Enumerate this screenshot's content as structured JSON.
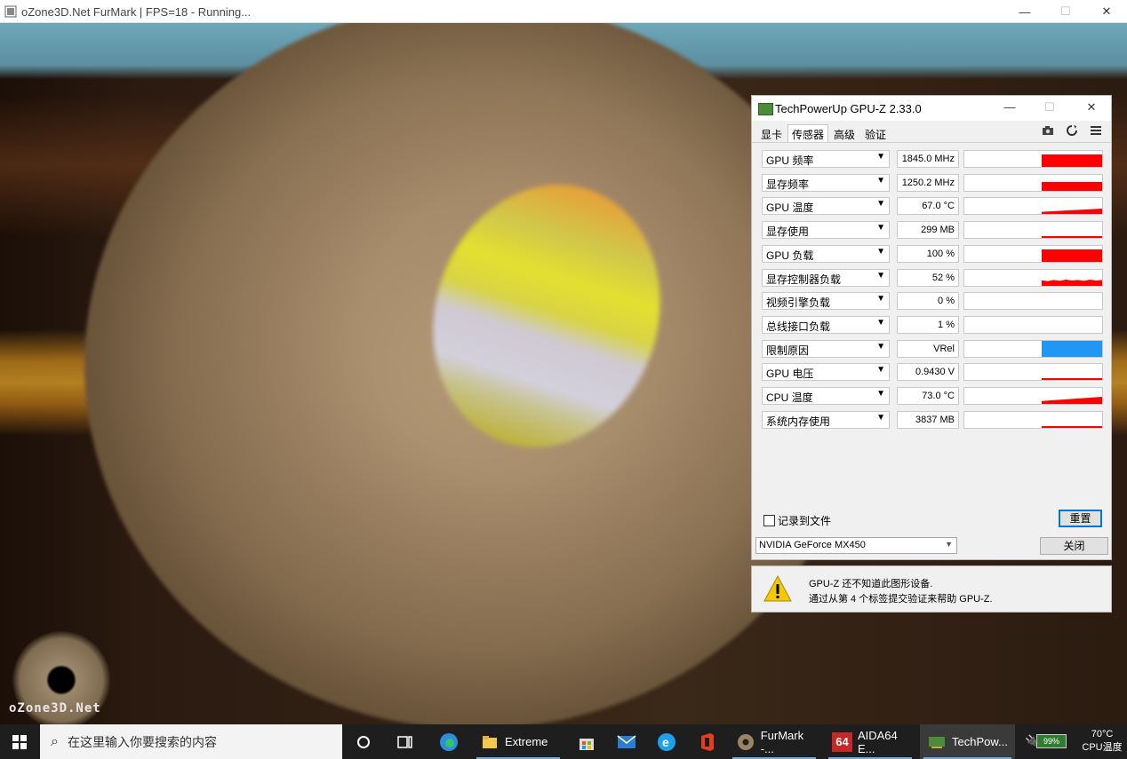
{
  "furmark": {
    "title": "oZone3D.Net FurMark | FPS=18 - Running...",
    "watermark": "oZone3D.Net"
  },
  "gpuz": {
    "title": "TechPowerUp GPU-Z 2.33.0",
    "tabs": [
      "显卡",
      "传感器",
      "高级",
      "验证"
    ],
    "active_tab": "传感器",
    "sensors": [
      {
        "name": "GPU 频率",
        "value": "1845.0 MHz",
        "level": 1.0,
        "shape": "full"
      },
      {
        "name": "显存频率",
        "value": "1250.2 MHz",
        "level": 0.7,
        "shape": "full"
      },
      {
        "name": "GPU 温度",
        "value": "67.0 °C",
        "level": 0.45,
        "shape": "ramp"
      },
      {
        "name": "显存使用",
        "value": "299 MB",
        "level": 0.1,
        "shape": "flat"
      },
      {
        "name": "GPU 负载",
        "value": "100 %",
        "level": 1.0,
        "shape": "full"
      },
      {
        "name": "显存控制器负载",
        "value": "52 %",
        "level": 0.5,
        "shape": "noisy"
      },
      {
        "name": "视频引擎负载",
        "value": "0 %",
        "level": 0.0,
        "shape": "flat"
      },
      {
        "name": "总线接口负载",
        "value": "1 %",
        "level": 0.02,
        "shape": "flat"
      },
      {
        "name": "限制原因",
        "value": "VRel",
        "level": 1.0,
        "shape": "blue"
      },
      {
        "name": "GPU 电压",
        "value": "0.9430 V",
        "level": 0.3,
        "shape": "flat"
      },
      {
        "name": "CPU 温度",
        "value": "73.0 °C",
        "level": 0.55,
        "shape": "ramp"
      },
      {
        "name": "系统内存使用",
        "value": "3837 MB",
        "level": 0.15,
        "shape": "flat"
      }
    ],
    "log_to_file_label": "记录到文件",
    "reset_label": "重置",
    "device": "NVIDIA GeForce MX450",
    "close_label": "关闭",
    "colors": {
      "graph": "#ff0000",
      "limit": "#2196f3"
    }
  },
  "gpuz_info": {
    "line1": "GPU-Z 还不知道此图形设备.",
    "line2": "通过从第 4 个标签提交验证来帮助 GPU-Z."
  },
  "taskbar": {
    "search_placeholder": "在这里输入你要搜索的内容",
    "apps": [
      {
        "name": "Extreme"
      },
      {
        "name": "FurMark -..."
      },
      {
        "name": "AIDA64 E..."
      },
      {
        "name": "TechPow..."
      }
    ],
    "aida_badge": "64",
    "battery": "99%",
    "temp_value": "70°C",
    "temp_label": "CPU温度"
  }
}
